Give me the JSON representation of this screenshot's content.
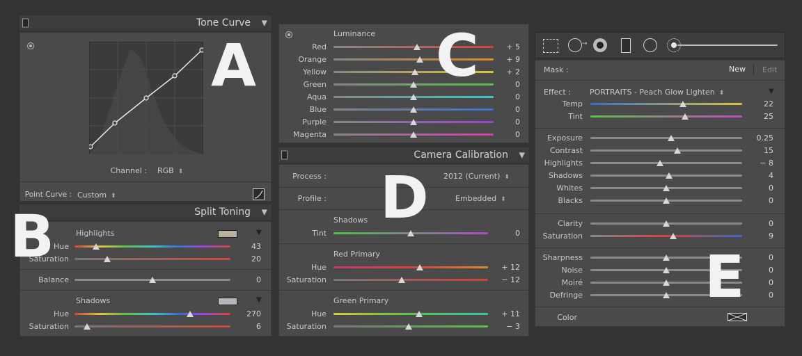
{
  "colors": {
    "red": "#d4413c",
    "orange": "#dc8a2a",
    "yellow": "#d8c63a",
    "green": "#5cc24a",
    "aqua": "#3cc6c6",
    "blue": "#3a6fd0",
    "purple": "#9a44d2",
    "magenta": "#d33fb0"
  },
  "labels": {
    "A": "A",
    "B": "B",
    "C": "C",
    "D": "D",
    "E": "E"
  },
  "tone_curve": {
    "title": "Tone Curve",
    "channel_label": "Channel :",
    "channel_value": "RGB",
    "point_curve_label": "Point Curve :",
    "point_curve_value": "Custom"
  },
  "split_toning": {
    "title": "Split Toning",
    "highlights_label": "Highlights",
    "highlights_hue": {
      "label": "Hue",
      "value": "43",
      "pos": 0.14
    },
    "highlights_sat": {
      "label": "Saturation",
      "value": "20",
      "pos": 0.21
    },
    "balance": {
      "label": "Balance",
      "value": "0",
      "pos": 0.5
    },
    "shadows_label": "Shadows",
    "shadows_hue": {
      "label": "Hue",
      "value": "270",
      "pos": 0.74
    },
    "shadows_sat": {
      "label": "Saturation",
      "value": "6",
      "pos": 0.08
    }
  },
  "luminance": {
    "title": "Luminance",
    "rows": [
      {
        "label": "Red",
        "value": "+ 5",
        "pos": 0.52,
        "color": "red"
      },
      {
        "label": "Orange",
        "value": "+ 9",
        "pos": 0.54,
        "color": "orange"
      },
      {
        "label": "Yellow",
        "value": "+ 2",
        "pos": 0.51,
        "color": "yellow"
      },
      {
        "label": "Green",
        "value": "0",
        "pos": 0.5,
        "color": "green"
      },
      {
        "label": "Aqua",
        "value": "0",
        "pos": 0.5,
        "color": "aqua"
      },
      {
        "label": "Blue",
        "value": "0",
        "pos": 0.5,
        "color": "blue"
      },
      {
        "label": "Purple",
        "value": "0",
        "pos": 0.5,
        "color": "purple"
      },
      {
        "label": "Magenta",
        "value": "0",
        "pos": 0.5,
        "color": "magenta"
      }
    ]
  },
  "camera_calibration": {
    "title": "Camera Calibration",
    "process_label": "Process :",
    "process_value": "2012 (Current)",
    "profile_label": "Profile :",
    "profile_value": "Embedded",
    "shadows_label": "Shadows",
    "tint": {
      "label": "Tint",
      "value": "0",
      "pos": 0.5
    },
    "red_primary_label": "Red Primary",
    "red_hue": {
      "label": "Hue",
      "value": "+ 12",
      "pos": 0.56
    },
    "red_sat": {
      "label": "Saturation",
      "value": "− 12",
      "pos": 0.44
    },
    "green_primary_label": "Green Primary",
    "green_hue": {
      "label": "Hue",
      "value": "+ 11",
      "pos": 0.555
    },
    "green_sat": {
      "label": "Saturation",
      "value": "− 3",
      "pos": 0.485
    }
  },
  "adjustment_brush": {
    "mask_label": "Mask :",
    "new_label": "New",
    "edit_label": "Edit",
    "effect_label": "Effect :",
    "effect_value": "PORTRAITS - Peach Glow Lighten",
    "rows1": [
      {
        "label": "Temp",
        "value": "22",
        "pos": 0.61,
        "track": "temp"
      },
      {
        "label": "Tint",
        "value": "25",
        "pos": 0.625,
        "track": "tint"
      }
    ],
    "rows2": [
      {
        "label": "Exposure",
        "value": "0.25",
        "pos": 0.53
      },
      {
        "label": "Contrast",
        "value": "15",
        "pos": 0.575
      },
      {
        "label": "Highlights",
        "value": "− 8",
        "pos": 0.46
      },
      {
        "label": "Shadows",
        "value": "4",
        "pos": 0.52
      },
      {
        "label": "Whites",
        "value": "0",
        "pos": 0.5
      },
      {
        "label": "Blacks",
        "value": "0",
        "pos": 0.5
      }
    ],
    "rows3": [
      {
        "label": "Clarity",
        "value": "0",
        "pos": 0.5,
        "track": "plain"
      },
      {
        "label": "Saturation",
        "value": "9",
        "pos": 0.545,
        "track": "sat"
      }
    ],
    "rows4": [
      {
        "label": "Sharpness",
        "value": "0",
        "pos": 0.5
      },
      {
        "label": "Noise",
        "value": "0",
        "pos": 0.5
      },
      {
        "label": "Moiré",
        "value": "0",
        "pos": 0.5
      },
      {
        "label": "Defringe",
        "value": "0",
        "pos": 0.5
      }
    ],
    "color_label": "Color"
  }
}
